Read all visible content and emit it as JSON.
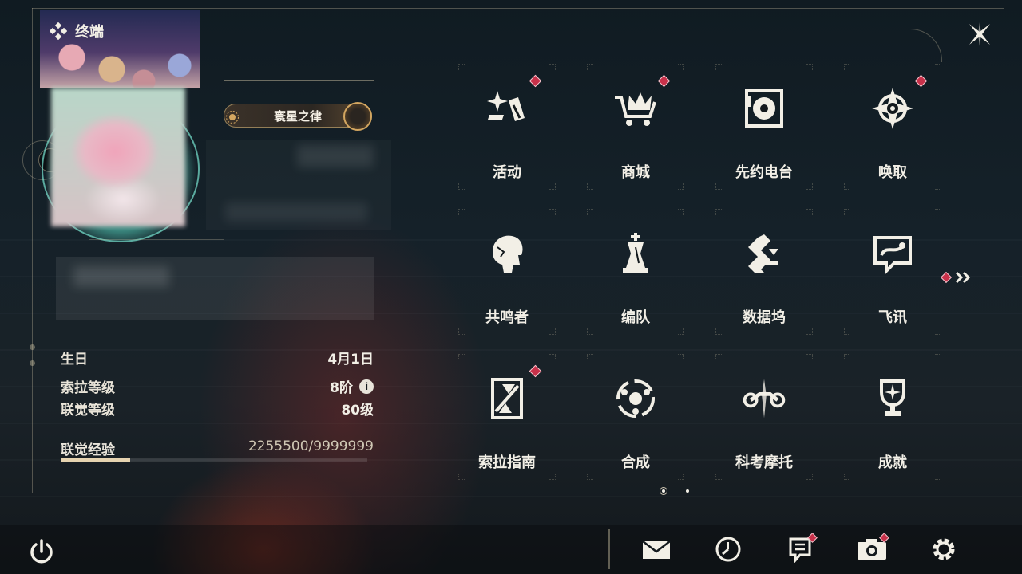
{
  "header": {
    "title": "终端"
  },
  "profile": {
    "title_badge": "寰星之律"
  },
  "stats": [
    {
      "label": "生日",
      "value": "4月1日"
    },
    {
      "label": "索拉等级",
      "value": "8阶"
    },
    {
      "label": "联觉等级",
      "value": "80级"
    }
  ],
  "experience": {
    "label": "联觉经验",
    "value": "2255500/9999999",
    "progress_fraction": 0.2256
  },
  "menu": [
    {
      "label": "活动",
      "icon": "sparkle-activity-icon",
      "notify": true
    },
    {
      "label": "商城",
      "icon": "crown-cart-icon",
      "notify": true
    },
    {
      "label": "先约电台",
      "icon": "radio-turntable-icon",
      "notify": false
    },
    {
      "label": "唤取",
      "icon": "compass-star-icon",
      "notify": true
    },
    {
      "label": "共鸣者",
      "icon": "character-head-icon",
      "notify": false
    },
    {
      "label": "编队",
      "icon": "chess-piece-icon",
      "notify": false
    },
    {
      "label": "数据坞",
      "icon": "data-dock-icon",
      "notify": false
    },
    {
      "label": "飞讯",
      "icon": "message-bubble-icon",
      "notify": false
    },
    {
      "label": "索拉指南",
      "icon": "guide-book-icon",
      "notify": true
    },
    {
      "label": "合成",
      "icon": "synthesis-orbit-icon",
      "notify": false
    },
    {
      "label": "科考摩托",
      "icon": "motorbike-icon",
      "notify": false
    },
    {
      "label": "成就",
      "icon": "trophy-icon",
      "notify": false
    }
  ],
  "pagination": {
    "current": 1,
    "total": 2
  },
  "bottom_bar": [
    {
      "name": "mail-button",
      "icon": "mail-icon",
      "notify": false
    },
    {
      "name": "clock-button",
      "icon": "clock-icon",
      "notify": false
    },
    {
      "name": "notice-button",
      "icon": "notice-icon",
      "notify": true
    },
    {
      "name": "camera-button",
      "icon": "camera-icon",
      "notify": true
    },
    {
      "name": "settings-button",
      "icon": "gear-icon",
      "notify": false
    }
  ],
  "colors": {
    "accent_gold": "#e6d3b0",
    "notify_red": "#c8314a",
    "avatar_glow": "#5ad2be"
  }
}
